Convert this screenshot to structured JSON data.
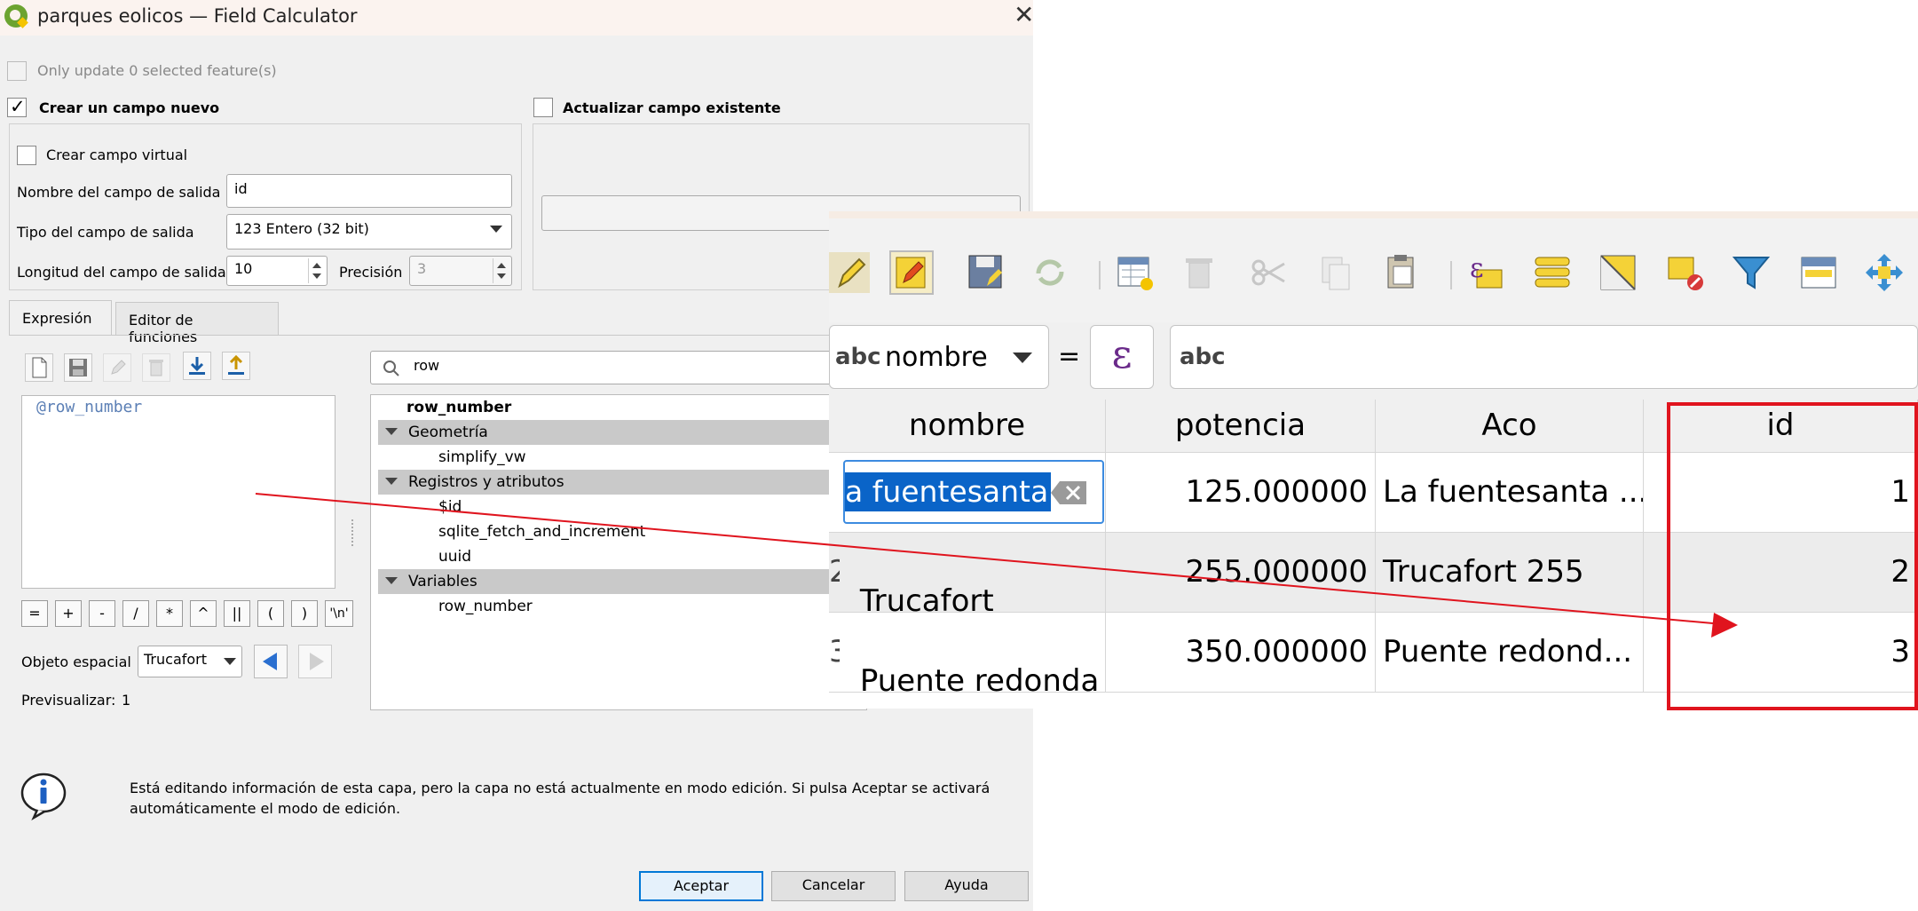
{
  "dialog": {
    "title": "parques eolicos — Field Calculator",
    "only_update_label": "Only update 0 selected feature(s)",
    "create_new_label": "Crear un campo nuevo",
    "update_existing_label": "Actualizar campo existente",
    "virtual_field_label": "Crear campo virtual",
    "output_name_label": "Nombre del campo de salida",
    "output_name_value": "id",
    "output_type_label": "Tipo del campo de salida",
    "output_type_value": "123 Entero (32 bit)",
    "output_length_label": "Longitud del campo de salida",
    "output_length_value": "10",
    "precision_label": "Precisión",
    "precision_value": "3",
    "tabs": [
      "Expresión",
      "Editor de funciones"
    ],
    "expression_text": "@row_number",
    "search_value": "row",
    "operators": [
      "=",
      "+",
      "-",
      "/",
      "*",
      "^",
      "||",
      "(",
      ")",
      "'\\n'"
    ],
    "feature_label": "Objeto espacial",
    "feature_value": "Trucafort",
    "preview_label": "Previsualizar:",
    "preview_value": "1",
    "info_text": "Está editando información de esta capa, pero la capa no está actualmente en modo edición. Si pulsa Aceptar se activará automáticamente el modo de edición.",
    "buttons": {
      "ok": "Aceptar",
      "cancel": "Cancelar",
      "help": "Ayuda"
    }
  },
  "function_tree": {
    "top_item": "row_number",
    "groups": [
      {
        "name": "Geometría",
        "items": [
          "simplify_vw"
        ]
      },
      {
        "name": "Registros y atributos",
        "items": [
          "$id",
          "sqlite_fetch_and_increment",
          "uuid"
        ]
      },
      {
        "name": "Variables",
        "items": [
          "row_number"
        ]
      }
    ]
  },
  "attribute_table": {
    "field_selector": "nombre",
    "field_type_prefix": "abc",
    "equals": "=",
    "epsilon": "ε",
    "value_placeholder": "abc",
    "columns": [
      "nombre",
      "potencia",
      "Aco",
      "id"
    ],
    "rows": [
      {
        "nombre": "a fuentesanta",
        "potencia": "125.000000",
        "aco": "La fuentesanta ...",
        "id": "1"
      },
      {
        "nombre": "Trucafort",
        "potencia": "255.000000",
        "aco": "Trucafort  255",
        "id": "2"
      },
      {
        "nombre": "Puente redonda",
        "potencia": "350.000000",
        "aco": "Puente redond...",
        "id": "3"
      }
    ],
    "row_number_fragments": [
      "2",
      "3"
    ]
  },
  "annotation": {
    "highlight_color": "#e0141e",
    "arrow_color": "#e0141e"
  },
  "colors": {
    "tree_group_bg": "#c9c9c9",
    "selection": "#0a64c8"
  }
}
